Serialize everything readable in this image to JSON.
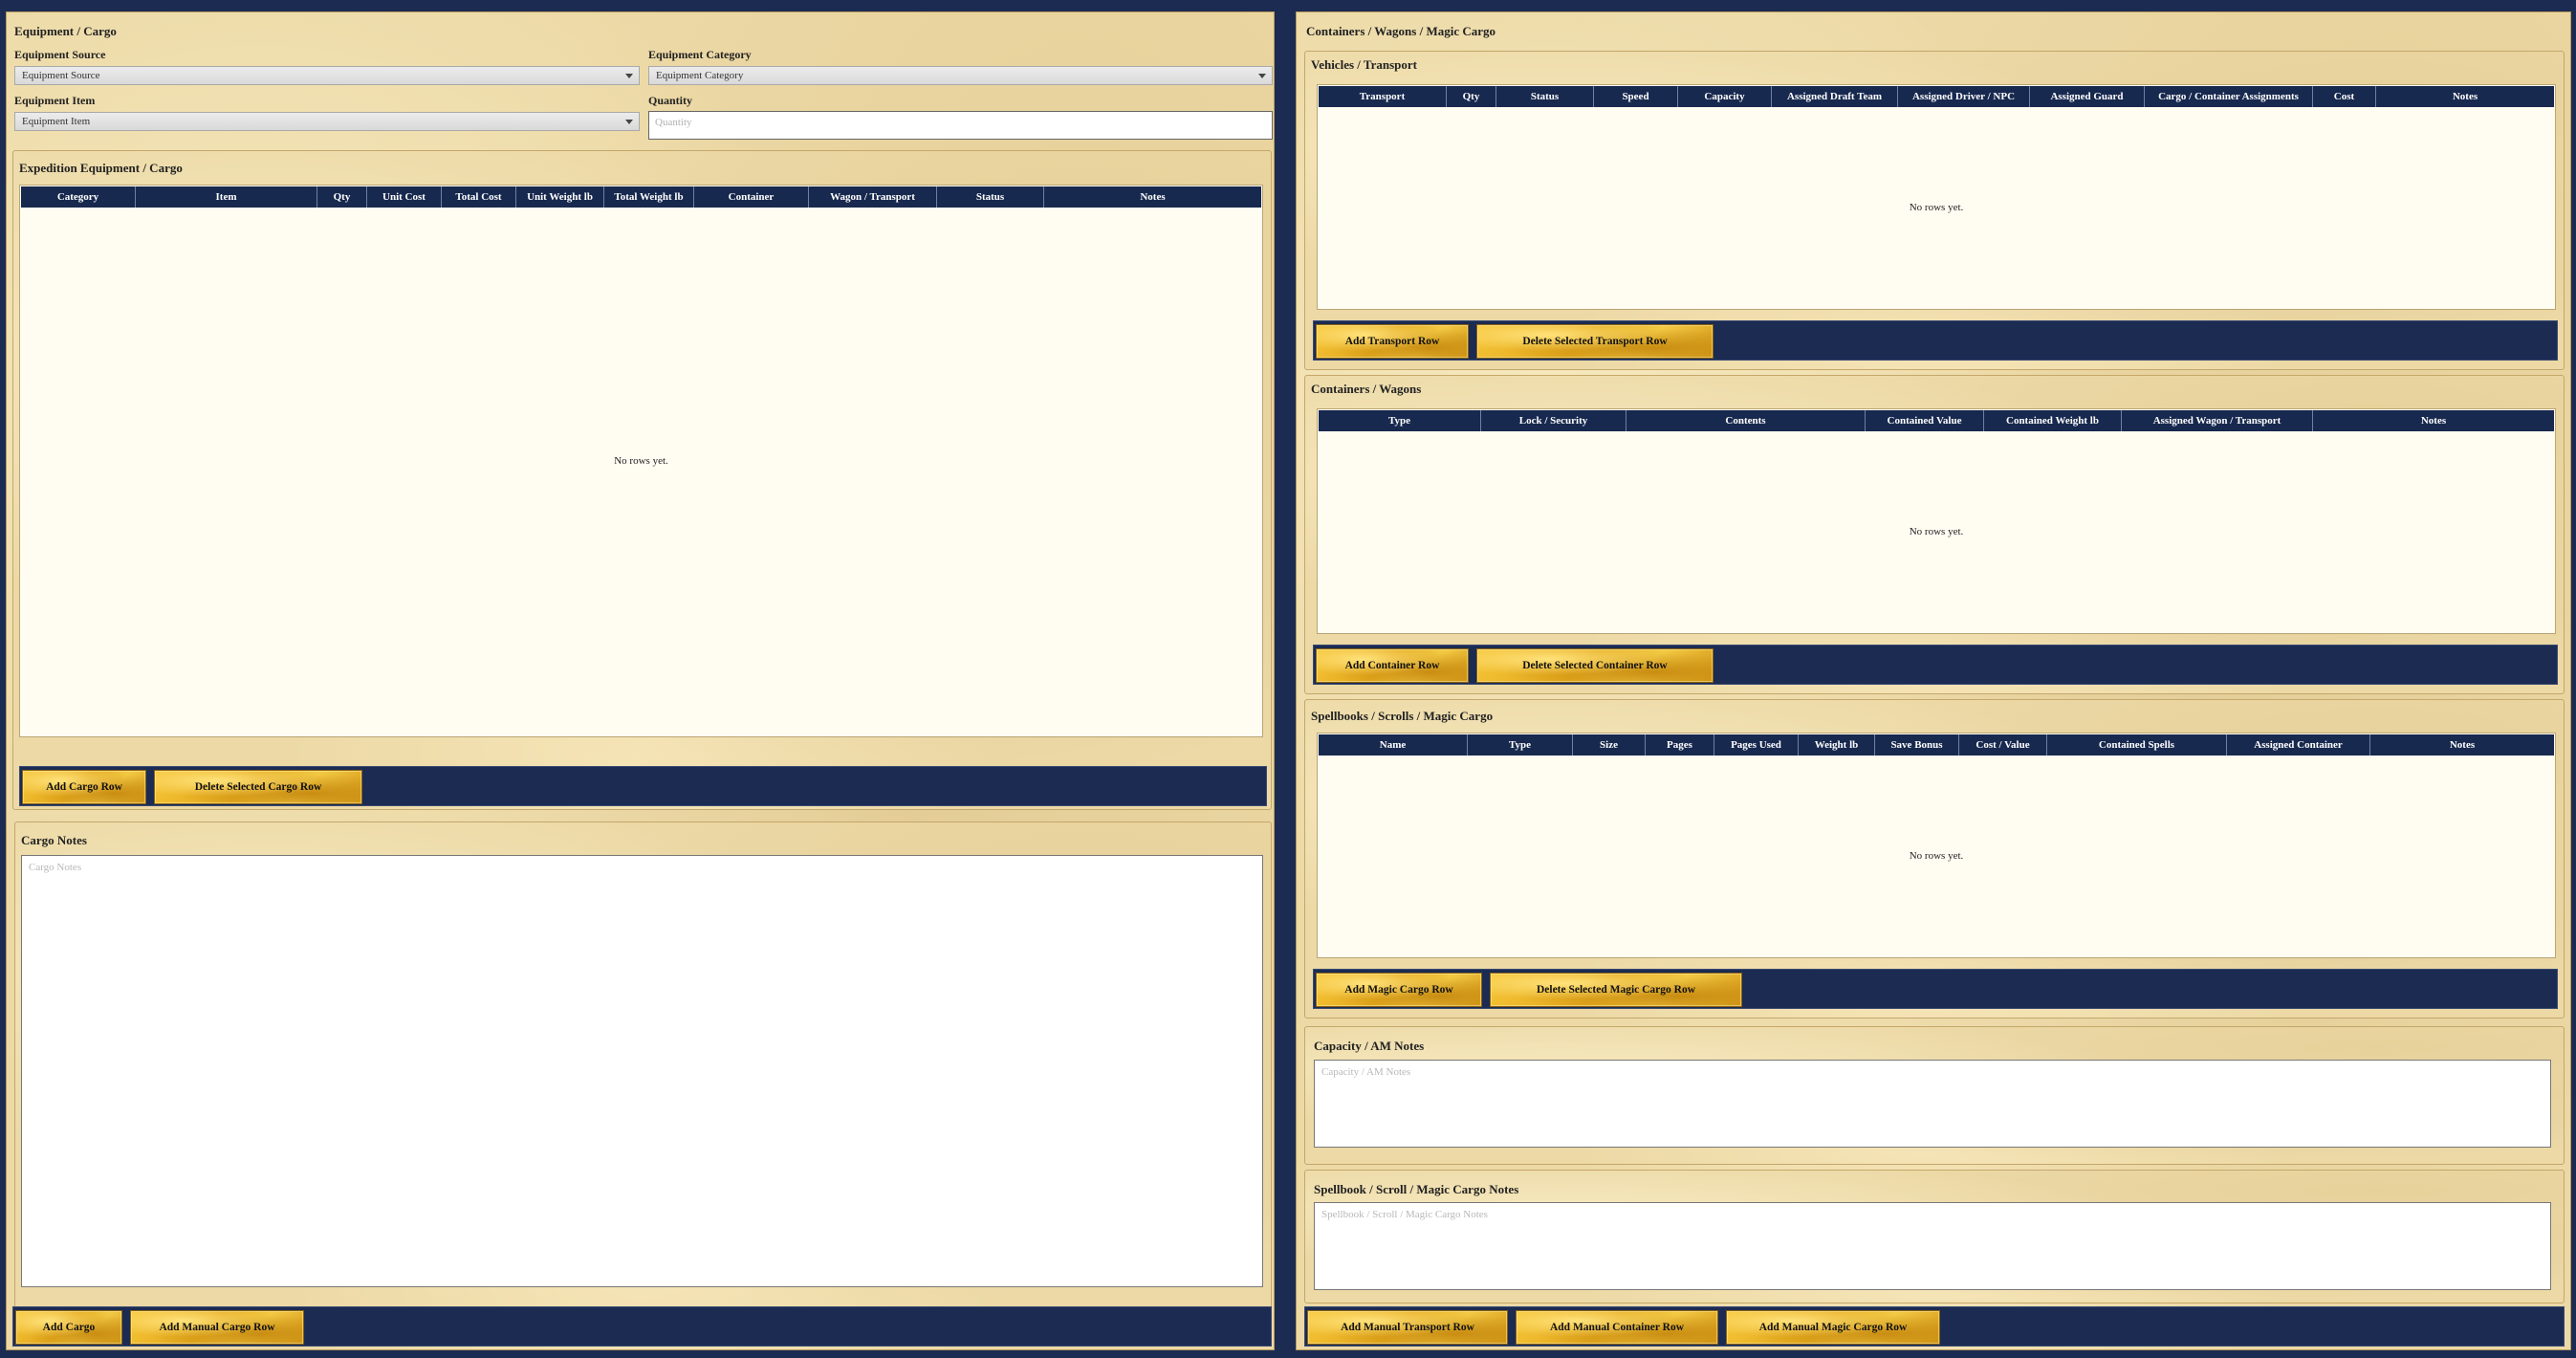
{
  "left": {
    "title": "Equipment / Cargo",
    "source_label": "Equipment Source",
    "source_value": "Equipment Source",
    "category_label": "Equipment Category",
    "category_value": "Equipment Category",
    "item_label": "Equipment Item",
    "item_value": "Equipment Item",
    "quantity_label": "Quantity",
    "quantity_placeholder": "Quantity",
    "expedition": {
      "title": "Expedition Equipment / Cargo",
      "columns": [
        "Category",
        "Item",
        "Qty",
        "Unit Cost",
        "Total Cost",
        "Unit Weight lb",
        "Total Weight lb",
        "Container",
        "Wagon / Transport",
        "Status",
        "Notes"
      ],
      "empty": "No rows yet.",
      "add_button": "Add Cargo Row",
      "delete_button": "Delete Selected Cargo Row"
    },
    "notes": {
      "title": "Cargo Notes",
      "placeholder": "Cargo Notes"
    },
    "bottom_buttons": [
      "Add Cargo",
      "Add Manual Cargo Row"
    ]
  },
  "right": {
    "title": "Containers / Wagons / Magic Cargo",
    "vehicles": {
      "title": "Vehicles / Transport",
      "columns": [
        "Transport",
        "Qty",
        "Status",
        "Speed",
        "Capacity",
        "Assigned Draft Team",
        "Assigned Driver / NPC",
        "Assigned Guard",
        "Cargo / Container Assignments",
        "Cost",
        "Notes"
      ],
      "empty": "No rows yet.",
      "add_button": "Add Transport Row",
      "delete_button": "Delete Selected Transport Row"
    },
    "containers": {
      "title": "Containers / Wagons",
      "columns": [
        "Type",
        "Lock / Security",
        "Contents",
        "Contained Value",
        "Contained Weight lb",
        "Assigned Wagon / Transport",
        "Notes"
      ],
      "empty": "No rows yet.",
      "add_button": "Add Container Row",
      "delete_button": "Delete Selected Container Row"
    },
    "magic": {
      "title": "Spellbooks / Scrolls / Magic Cargo",
      "columns": [
        "Name",
        "Type",
        "Size",
        "Pages",
        "Pages Used",
        "Weight lb",
        "Save Bonus",
        "Cost / Value",
        "Contained Spells",
        "Assigned Container",
        "Notes"
      ],
      "empty": "No rows yet.",
      "add_button": "Add Magic Cargo Row",
      "delete_button": "Delete Selected Magic Cargo Row"
    },
    "capacity_notes": {
      "title": "Capacity / AM Notes",
      "placeholder": "Capacity / AM Notes"
    },
    "spell_notes": {
      "title": "Spellbook / Scroll / Magic Cargo Notes",
      "placeholder": "Spellbook / Scroll / Magic Cargo Notes"
    },
    "bottom_buttons": [
      "Add Manual Transport Row",
      "Add Manual Container Row",
      "Add Manual Magic Cargo Row"
    ]
  }
}
